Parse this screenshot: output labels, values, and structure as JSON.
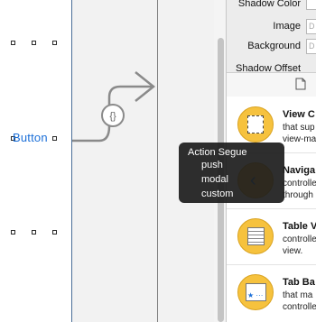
{
  "canvas": {
    "button_label": "Button"
  },
  "inspector": {
    "shadow_color_label": "Shadow Color",
    "image_label": "Image",
    "image_placeholder": "D",
    "background_label": "Background",
    "background_placeholder": "D",
    "shadow_offset_label": "Shadow Offset"
  },
  "library": {
    "items": [
      {
        "title": "View C",
        "desc": "that sup\nview-ma"
      },
      {
        "title": "Naviga",
        "desc": "controlle\nthrough"
      },
      {
        "title": "Table V",
        "desc": "controlle\nview."
      },
      {
        "title": "Tab Ba",
        "desc": "that ma\ncontrolle"
      }
    ]
  },
  "segue_popup": {
    "header": "Action Segue",
    "options": [
      "push",
      "modal",
      "custom"
    ]
  },
  "colors": {
    "accent_blue": "#1b6fd8",
    "library_icon": "#f6c23e"
  }
}
